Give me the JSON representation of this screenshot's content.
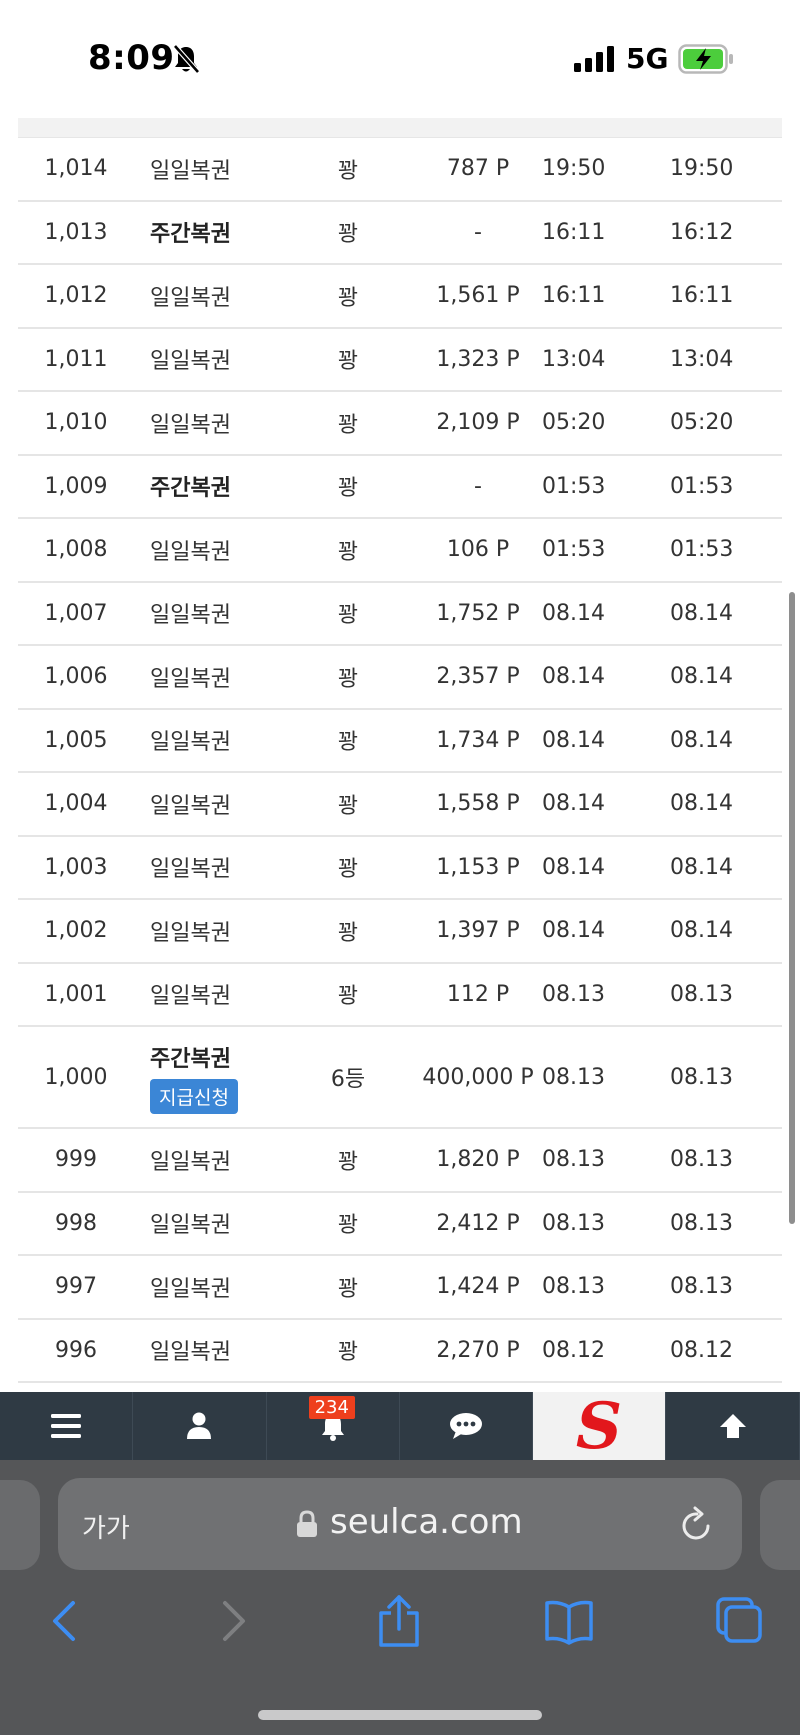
{
  "status_bar": {
    "time": "8:09",
    "network": "5G"
  },
  "rows": [
    {
      "no": "1,014",
      "type": "일일복권",
      "weekly": false,
      "result": "꽝",
      "points": "787 P",
      "time1": "19:50",
      "time2": "19:50"
    },
    {
      "no": "1,013",
      "type": "주간복권",
      "weekly": true,
      "result": "꽝",
      "points": "-",
      "time1": "16:11",
      "time2": "16:12"
    },
    {
      "no": "1,012",
      "type": "일일복권",
      "weekly": false,
      "result": "꽝",
      "points": "1,561 P",
      "time1": "16:11",
      "time2": "16:11"
    },
    {
      "no": "1,011",
      "type": "일일복권",
      "weekly": false,
      "result": "꽝",
      "points": "1,323 P",
      "time1": "13:04",
      "time2": "13:04"
    },
    {
      "no": "1,010",
      "type": "일일복권",
      "weekly": false,
      "result": "꽝",
      "points": "2,109 P",
      "time1": "05:20",
      "time2": "05:20"
    },
    {
      "no": "1,009",
      "type": "주간복권",
      "weekly": true,
      "result": "꽝",
      "points": "-",
      "time1": "01:53",
      "time2": "01:53"
    },
    {
      "no": "1,008",
      "type": "일일복권",
      "weekly": false,
      "result": "꽝",
      "points": "106 P",
      "time1": "01:53",
      "time2": "01:53"
    },
    {
      "no": "1,007",
      "type": "일일복권",
      "weekly": false,
      "result": "꽝",
      "points": "1,752 P",
      "time1": "08.14",
      "time2": "08.14"
    },
    {
      "no": "1,006",
      "type": "일일복권",
      "weekly": false,
      "result": "꽝",
      "points": "2,357 P",
      "time1": "08.14",
      "time2": "08.14"
    },
    {
      "no": "1,005",
      "type": "일일복권",
      "weekly": false,
      "result": "꽝",
      "points": "1,734 P",
      "time1": "08.14",
      "time2": "08.14"
    },
    {
      "no": "1,004",
      "type": "일일복권",
      "weekly": false,
      "result": "꽝",
      "points": "1,558 P",
      "time1": "08.14",
      "time2": "08.14"
    },
    {
      "no": "1,003",
      "type": "일일복권",
      "weekly": false,
      "result": "꽝",
      "points": "1,153 P",
      "time1": "08.14",
      "time2": "08.14"
    },
    {
      "no": "1,002",
      "type": "일일복권",
      "weekly": false,
      "result": "꽝",
      "points": "1,397 P",
      "time1": "08.14",
      "time2": "08.14"
    },
    {
      "no": "1,001",
      "type": "일일복권",
      "weekly": false,
      "result": "꽝",
      "points": "112 P",
      "time1": "08.13",
      "time2": "08.13"
    },
    {
      "no": "1,000",
      "type": "주간복권",
      "weekly": true,
      "result": "6등",
      "points": "400,000 P",
      "time1": "08.13",
      "time2": "08.13",
      "action": "지급신청"
    },
    {
      "no": "999",
      "type": "일일복권",
      "weekly": false,
      "result": "꽝",
      "points": "1,820 P",
      "time1": "08.13",
      "time2": "08.13"
    },
    {
      "no": "998",
      "type": "일일복권",
      "weekly": false,
      "result": "꽝",
      "points": "2,412 P",
      "time1": "08.13",
      "time2": "08.13"
    },
    {
      "no": "997",
      "type": "일일복권",
      "weekly": false,
      "result": "꽝",
      "points": "1,424 P",
      "time1": "08.13",
      "time2": "08.13"
    },
    {
      "no": "996",
      "type": "일일복권",
      "weekly": false,
      "result": "꽝",
      "points": "2,270 P",
      "time1": "08.12",
      "time2": "08.12"
    }
  ],
  "site_nav": {
    "items": [
      "menu-icon",
      "user-icon",
      "bell-icon",
      "chat-icon",
      "site-logo",
      "arrow-up-icon"
    ],
    "notification_count": "234",
    "logo_letter": "S",
    "colors": {
      "bar": "#2f3a44",
      "badge": "#ee3f1d",
      "logo": "#e2171c"
    }
  },
  "browser": {
    "text_size_label": "가가",
    "url": "seulca.com",
    "toolbar": [
      "back-icon",
      "forward-icon",
      "share-icon",
      "bookmarks-icon",
      "tabs-icon"
    ],
    "colors": {
      "accent": "#3d8df2"
    }
  }
}
